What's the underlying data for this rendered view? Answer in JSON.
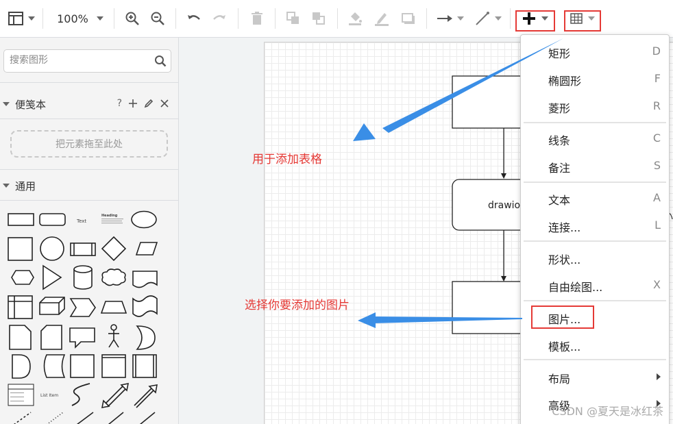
{
  "toolbar": {
    "zoom": "100%",
    "insert_icon": "plus-icon",
    "table_icon": "table-icon"
  },
  "sidebar": {
    "search_placeholder": "搜索图形",
    "scratchpad_title": "便笺本",
    "scratchpad_help": "?",
    "scratchpad_drop": "把元素拖至此处",
    "general_title": "通用",
    "shape_labels": {
      "text": "Text",
      "heading": "Heading",
      "list_item": "List Item"
    }
  },
  "canvas": {
    "node_label": "drawio"
  },
  "annotations": {
    "table_hint": "用于添加表格",
    "image_hint": "选择你要添加的图片"
  },
  "menu": {
    "items": [
      {
        "label": "矩形",
        "key": "D"
      },
      {
        "label": "椭圆形",
        "key": "F"
      },
      {
        "label": "菱形",
        "key": "R"
      },
      {
        "label": "线条",
        "key": "C"
      },
      {
        "label": "备注",
        "key": "S"
      },
      {
        "label": "文本",
        "key": "A"
      },
      {
        "label": "连接...",
        "key": "L"
      },
      {
        "label": "形状...",
        "key": ""
      },
      {
        "label": "自由绘图...",
        "key": "X"
      },
      {
        "label": "图片...",
        "key": ""
      },
      {
        "label": "模板...",
        "key": ""
      },
      {
        "label": "布局",
        "key": ""
      },
      {
        "label": "高级",
        "key": ""
      }
    ]
  },
  "watermark": "CSDN @夏天是冰红茶",
  "colors": {
    "highlight": "#e53935",
    "arrow": "#3a8ee6"
  }
}
